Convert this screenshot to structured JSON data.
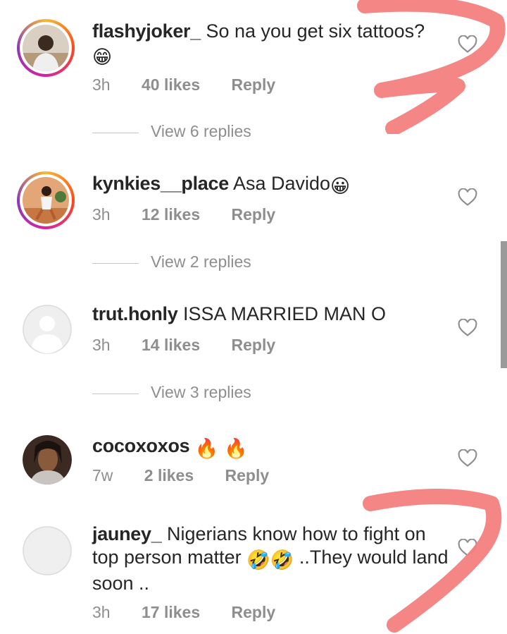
{
  "comments": [
    {
      "username": "flashyjoker_",
      "text": "So na you get six tattoos?",
      "emoji": "😁",
      "time": "3h",
      "likes": "40 likes",
      "reply": "Reply",
      "view_replies": "View 6 replies"
    },
    {
      "username": "kynkies__place",
      "text": "Asa Davido",
      "emoji": "😀",
      "time": "3h",
      "likes": "12 likes",
      "reply": "Reply",
      "view_replies": "View 2 replies"
    },
    {
      "username": "trut.honly",
      "text": "ISSA MARRIED MAN O",
      "time": "3h",
      "likes": "14 likes",
      "reply": "Reply",
      "view_replies": "View 3 replies"
    },
    {
      "username": "cocoxoxos",
      "emoji": "🔥 🔥",
      "time": "7w",
      "likes": "2 likes",
      "reply": "Reply"
    },
    {
      "username": "jauney_",
      "text_part1": "Nigerians know how to fight on top person matter",
      "emoji": "🤣🤣",
      "text_part2": "..They would land soon ..",
      "time": "3h",
      "likes": "17 likes",
      "reply": "Reply"
    }
  ],
  "colors": {
    "text": "#262626",
    "muted": "#8e8e8e",
    "scribble": "#f47f7f"
  },
  "icons": {
    "like": "heart-outline-icon",
    "default_avatar": "default-avatar-icon"
  }
}
